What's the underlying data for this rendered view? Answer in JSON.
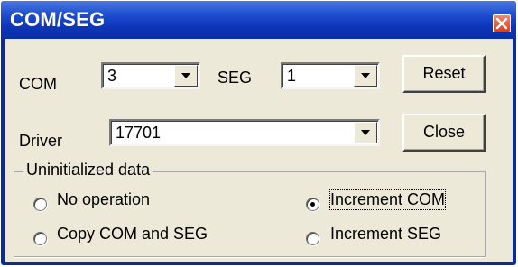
{
  "window": {
    "title": "COM/SEG",
    "close_icon": "close-icon"
  },
  "com": {
    "label": "COM",
    "value": "3"
  },
  "seg": {
    "label": "SEG",
    "value": "1"
  },
  "driver": {
    "label": "Driver",
    "value": "17701"
  },
  "buttons": {
    "reset": "Reset",
    "close": "Close"
  },
  "uninitialized": {
    "title": "Uninitialized data",
    "options": [
      {
        "label": "No operation",
        "selected": false
      },
      {
        "label": "Increment COM",
        "selected": true
      },
      {
        "label": "Copy COM and SEG",
        "selected": false
      },
      {
        "label": "Increment SEG",
        "selected": false
      }
    ]
  },
  "colors": {
    "titlebar": "#0c35b8",
    "dialog_bg": "#ece9d8",
    "close_button": "#d6401f"
  }
}
